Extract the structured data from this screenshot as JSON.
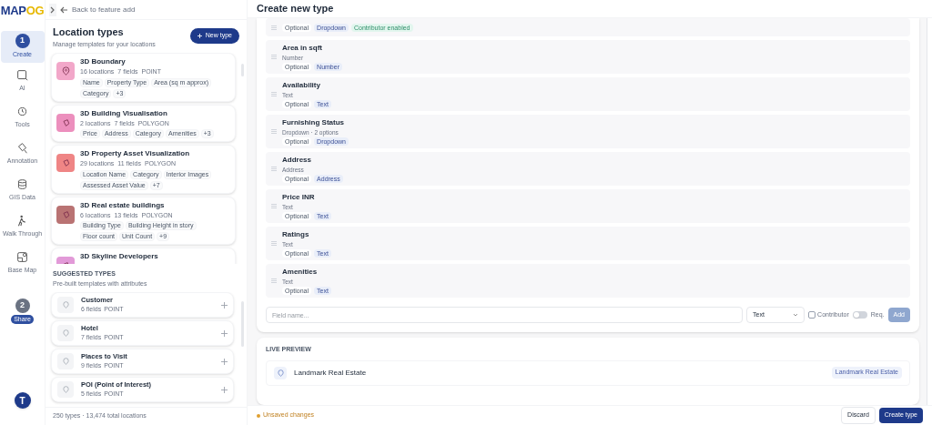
{
  "logo": "MAPOG",
  "back_link": "Back to feature add",
  "rail": [
    {
      "label": "Create",
      "step": "1",
      "selected": true,
      "kind": "step"
    },
    {
      "label": "AI",
      "selected": false,
      "kind": "tool"
    },
    {
      "label": "Tools",
      "selected": false,
      "kind": "tool"
    },
    {
      "label": "Annotation",
      "selected": false,
      "kind": "tool"
    },
    {
      "label": "GIS Data",
      "selected": false,
      "kind": "tool"
    },
    {
      "label": "Walk Through",
      "selected": false,
      "kind": "tool"
    },
    {
      "label": "Base Map",
      "selected": false,
      "kind": "tool"
    },
    {
      "label": "Share",
      "step": "2",
      "selected": false,
      "kind": "step"
    }
  ],
  "avatar": "T",
  "location_types": {
    "title": "Location types",
    "subtitle": "Manage templates for your locations",
    "new_button": "New type",
    "items": [
      {
        "name": "3D Boundary",
        "locations": "16 locations",
        "fields": "7 fields",
        "geometry": "POINT",
        "color": "#f2a7c9",
        "tags": [
          "Name",
          "Property Type",
          "Area (sq m approx)",
          "Category",
          "+3"
        ]
      },
      {
        "name": "3D Building Visualisation",
        "locations": "2 locations",
        "fields": "7 fields",
        "geometry": "POLYGON",
        "color": "#ec8fbd",
        "tags": [
          "Price",
          "Address",
          "Category",
          "Amenities",
          "+3"
        ]
      },
      {
        "name": "3D Property Asset Visualization",
        "locations": "29 locations",
        "fields": "11 fields",
        "geometry": "POLYGON",
        "color": "#ef8585",
        "tags": [
          "Location Name",
          "Category",
          "Interior Images",
          "Assessed Asset Value",
          "+7"
        ]
      },
      {
        "name": "3D Real estate buildings",
        "locations": "6 locations",
        "fields": "13 fields",
        "geometry": "POLYGON",
        "color": "#b97373",
        "tags": [
          "Building Type",
          "Building Height in story",
          "Floor count",
          "Unit Count",
          "+9"
        ]
      },
      {
        "name": "3D Skyline Developers",
        "color": "#e29ad8"
      }
    ]
  },
  "suggested": {
    "title": "SUGGESTED TYPES",
    "subtitle": "Pre-built templates with attributes",
    "items": [
      {
        "name": "Customer",
        "fields": "6 fields",
        "geometry": "POINT"
      },
      {
        "name": "Hotel",
        "fields": "7 fields",
        "geometry": "POINT"
      },
      {
        "name": "Places to Visit",
        "fields": "9 fields",
        "geometry": "POINT"
      },
      {
        "name": "POI (Point of Interest)",
        "fields": "5 fields",
        "geometry": "POINT"
      }
    ]
  },
  "summary": "250 types · 13,474 total locations",
  "main_title": "Create new type",
  "fields": [
    {
      "tags": [
        {
          "label": "Optional",
          "kind": "required"
        },
        {
          "label": "Dropdown",
          "kind": "type"
        },
        {
          "label": "Contributor enabled",
          "kind": "contributor"
        }
      ]
    },
    {
      "name": "Area in sqft",
      "type": "Number",
      "tags": [
        {
          "label": "Optional",
          "kind": "required"
        },
        {
          "label": "Number",
          "kind": "type"
        }
      ]
    },
    {
      "name": "Availability",
      "type": "Text",
      "tags": [
        {
          "label": "Optional",
          "kind": "required"
        },
        {
          "label": "Text",
          "kind": "type"
        }
      ]
    },
    {
      "name": "Furnishing Status",
      "type": "Dropdown · 2 options",
      "tags": [
        {
          "label": "Optional",
          "kind": "required"
        },
        {
          "label": "Dropdown",
          "kind": "type"
        }
      ]
    },
    {
      "name": "Address",
      "type": "Address",
      "tags": [
        {
          "label": "Optional",
          "kind": "required"
        },
        {
          "label": "Address",
          "kind": "type"
        }
      ]
    },
    {
      "name": "Price INR",
      "type": "Text",
      "tags": [
        {
          "label": "Optional",
          "kind": "required"
        },
        {
          "label": "Text",
          "kind": "type"
        }
      ]
    },
    {
      "name": "Ratings",
      "type": "Text",
      "tags": [
        {
          "label": "Optional",
          "kind": "required"
        },
        {
          "label": "Text",
          "kind": "type"
        }
      ]
    },
    {
      "name": "Amenities",
      "type": "Text",
      "tags": [
        {
          "label": "Optional",
          "kind": "required"
        },
        {
          "label": "Text",
          "kind": "type"
        }
      ]
    }
  ],
  "add_field": {
    "placeholder": "Field name...",
    "type": "Text",
    "contributor": {
      "label": "Contributor",
      "checked": false
    },
    "required": {
      "label": "Req.",
      "on": false
    },
    "button": "Add"
  },
  "live_preview": {
    "title": "LIVE PREVIEW",
    "name": "Landmark Real Estate",
    "badge": "Landmark Real Estate"
  },
  "footer": {
    "status": "Unsaved changes",
    "discard": "Discard",
    "create": "Create type"
  }
}
